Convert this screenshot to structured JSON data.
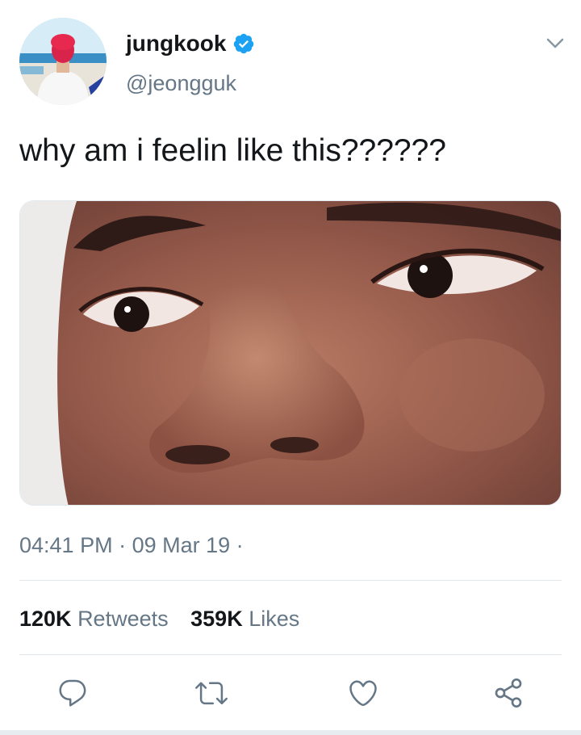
{
  "user": {
    "display_name": "jungkook",
    "handle": "@jeongguk",
    "verified": true,
    "avatar_icon": "profile-avatar",
    "verified_icon": "verified-badge-icon"
  },
  "tweet": {
    "text": "why am i feelin like this??????",
    "media_description_icon": "photo-closeup-face"
  },
  "meta": {
    "time": "04:41 PM",
    "separator": " · ",
    "date": "09 Mar 19",
    "trailing_separator": " ·"
  },
  "stats": {
    "retweets_count": "120K",
    "retweets_label": "Retweets",
    "likes_count": "359K",
    "likes_label": "Likes"
  },
  "actions": [
    {
      "name": "reply",
      "icon": "reply-icon"
    },
    {
      "name": "retweet",
      "icon": "retweet-icon"
    },
    {
      "name": "like",
      "icon": "heart-icon"
    },
    {
      "name": "share",
      "icon": "share-icon"
    }
  ],
  "colors": {
    "text_primary": "#14171a",
    "text_secondary": "#657786",
    "verified_blue": "#1da1f2",
    "divider": "#e1e8ed",
    "icon": "#657786"
  }
}
